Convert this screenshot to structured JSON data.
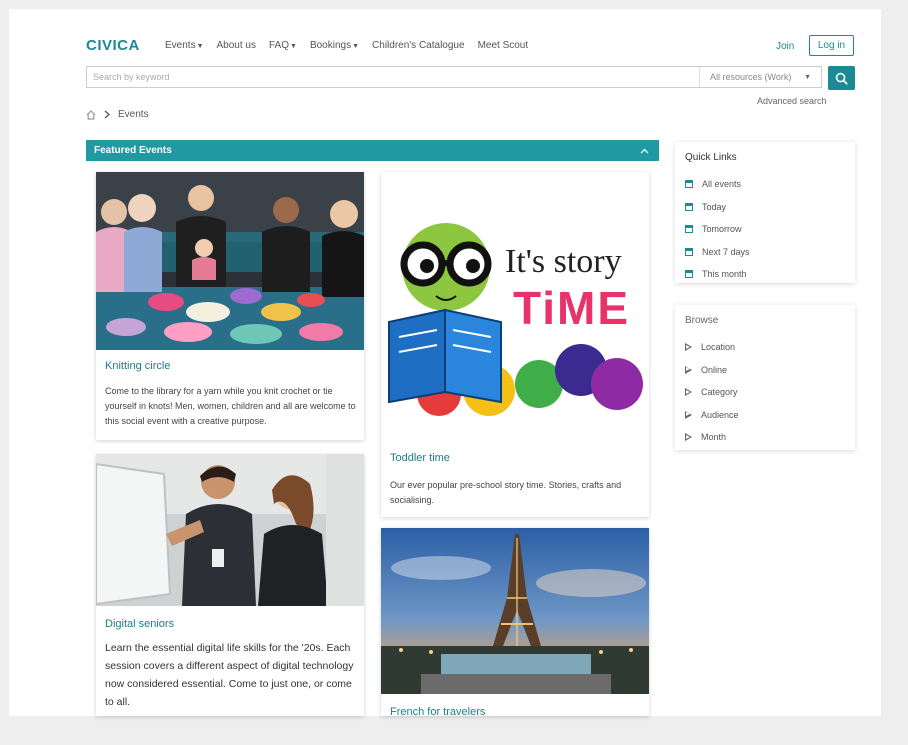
{
  "header": {
    "logo": "CIVICA",
    "nav": [
      {
        "label": "Events",
        "dropdown": true
      },
      {
        "label": "About us",
        "dropdown": false
      },
      {
        "label": "FAQ",
        "dropdown": true
      },
      {
        "label": "Bookings",
        "dropdown": true
      },
      {
        "label": "Children's Catalogue",
        "dropdown": false
      },
      {
        "label": "Meet Scout",
        "dropdown": false
      }
    ],
    "join": "Join",
    "login": "Log in"
  },
  "search": {
    "placeholder": "Search by keyword",
    "resource": "All resources (Work)",
    "advanced": "Advanced search"
  },
  "breadcrumb": {
    "current": "Events"
  },
  "featured": {
    "title": "Featured Events",
    "cards": [
      {
        "title": "Knitting circle",
        "desc": "Come to the library for a yarn while you knit crochet or tie yourself in knots! Men, women, children and all are welcome to this social event with a creative purpose."
      },
      {
        "title": "Toddler time",
        "desc": "Our ever popular pre-school story time. Stories, crafts and socialising.",
        "art_text_1": "It's story",
        "art_text_2": "TiME"
      },
      {
        "title": "Digital seniors",
        "desc": "Learn the essential digital life skills for the '20s. Each session covers a different aspect of digital technology now considered essential. Come to just one, or come to all."
      },
      {
        "title": "French for travelers",
        "desc": ""
      }
    ]
  },
  "quick_links": {
    "title": "Quick Links",
    "items": [
      "All events",
      "Today",
      "Tomorrow",
      "Next 7 days",
      "This month"
    ]
  },
  "browse": {
    "title": "Browse",
    "items": [
      "Location",
      "Online",
      "Category",
      "Audience",
      "Month"
    ]
  },
  "colors": {
    "accent": "#1a8a95",
    "featured_bar": "#1f9aa3"
  }
}
